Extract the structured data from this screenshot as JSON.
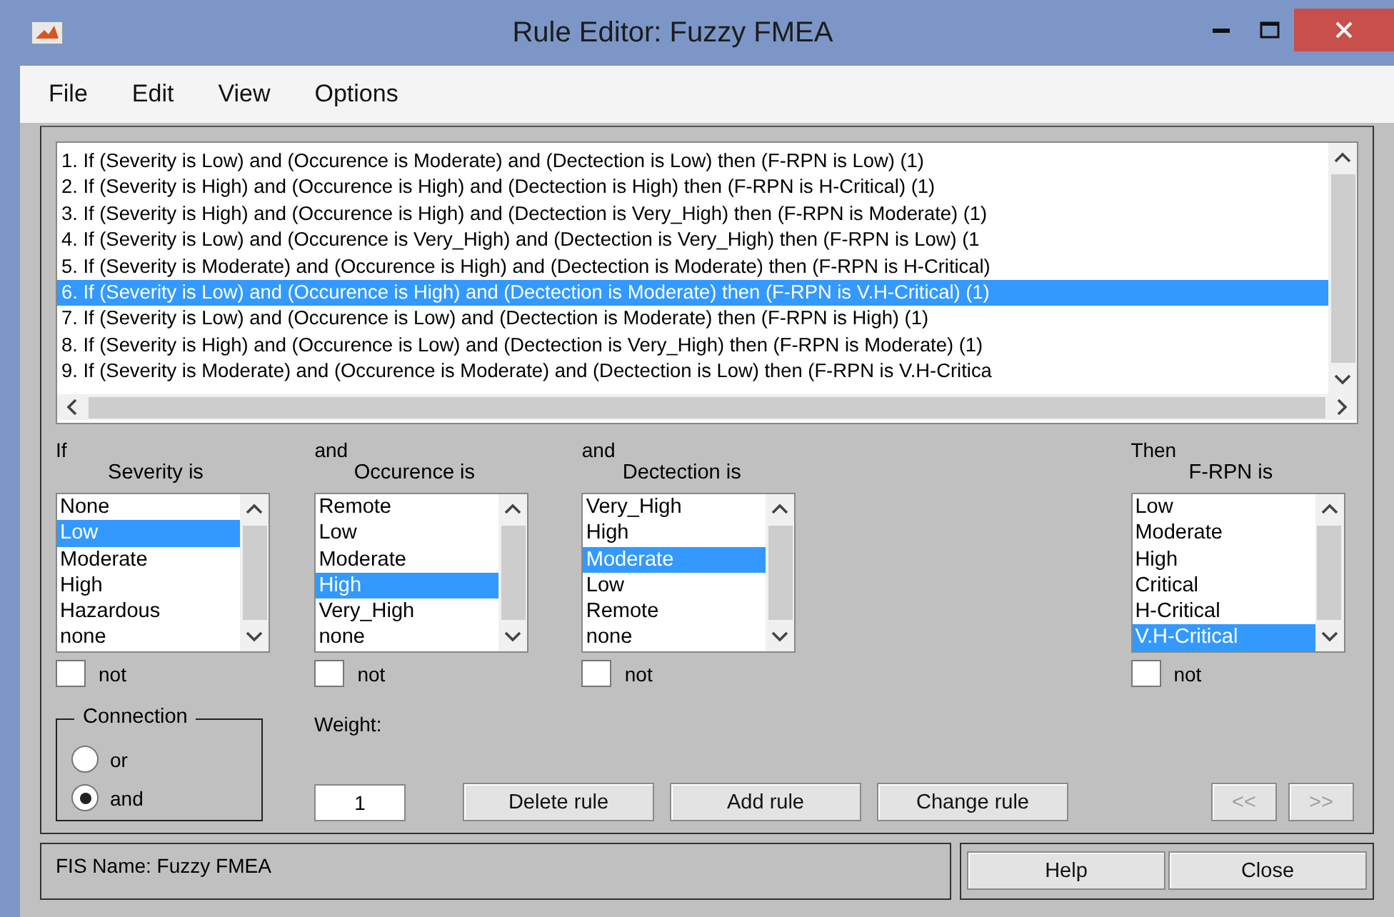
{
  "window": {
    "title": "Rule Editor: Fuzzy FMEA"
  },
  "menu": [
    "File",
    "Edit",
    "View",
    "Options"
  ],
  "rules": [
    {
      "text": "1. If (Severity is Low) and (Occurence is Moderate) and (Dectection is Low) then (F-RPN is Low) (1)",
      "selected": false
    },
    {
      "text": "2. If (Severity is High) and (Occurence is High) and (Dectection is High) then (F-RPN is H-Critical) (1)",
      "selected": false
    },
    {
      "text": "3. If (Severity is High) and (Occurence is High) and (Dectection is Very_High) then (F-RPN is Moderate) (1)",
      "selected": false
    },
    {
      "text": "4. If (Severity is Low) and (Occurence is Very_High) and (Dectection is Very_High) then (F-RPN is Low) (1",
      "selected": false
    },
    {
      "text": "5. If (Severity is Moderate) and (Occurence is High) and (Dectection is Moderate) then (F-RPN is H-Critical)",
      "selected": false
    },
    {
      "text": "6. If (Severity is Low) and (Occurence is High) and (Dectection is Moderate) then (F-RPN is V.H-Critical) (1)",
      "selected": true
    },
    {
      "text": "7. If (Severity is Low) and (Occurence is Low) and (Dectection is Moderate) then (F-RPN is High) (1)",
      "selected": false
    },
    {
      "text": "8. If (Severity is High) and (Occurence is Low) and (Dectection is Very_High) then (F-RPN is Moderate) (1)",
      "selected": false
    },
    {
      "text": "9. If (Severity is Moderate) and (Occurence is Moderate) and (Dectection is Low) then (F-RPN is V.H-Critica",
      "selected": false
    }
  ],
  "antecedents": [
    {
      "prefix": "If",
      "label": "Severity is",
      "not": false,
      "not_label": "not",
      "options": [
        {
          "label": "None",
          "selected": false
        },
        {
          "label": "Low",
          "selected": true
        },
        {
          "label": "Moderate",
          "selected": false
        },
        {
          "label": "High",
          "selected": false
        },
        {
          "label": "Hazardous",
          "selected": false
        },
        {
          "label": "none",
          "selected": false
        }
      ]
    },
    {
      "prefix": "and",
      "label": "Occurence is",
      "not": false,
      "not_label": "not",
      "options": [
        {
          "label": "Remote",
          "selected": false
        },
        {
          "label": "Low",
          "selected": false
        },
        {
          "label": "Moderate",
          "selected": false
        },
        {
          "label": "High",
          "selected": true
        },
        {
          "label": "Very_High",
          "selected": false
        },
        {
          "label": "none",
          "selected": false
        }
      ]
    },
    {
      "prefix": "and",
      "label": "Dectection is",
      "not": false,
      "not_label": "not",
      "options": [
        {
          "label": "Very_High",
          "selected": false
        },
        {
          "label": "High",
          "selected": false
        },
        {
          "label": "Moderate",
          "selected": true
        },
        {
          "label": "Low",
          "selected": false
        },
        {
          "label": "Remote",
          "selected": false
        },
        {
          "label": "none",
          "selected": false
        }
      ]
    }
  ],
  "consequent": {
    "prefix": "Then",
    "label": "F-RPN is",
    "not": false,
    "not_label": "not",
    "options": [
      {
        "label": "Low",
        "selected": false
      },
      {
        "label": "Moderate",
        "selected": false
      },
      {
        "label": "High",
        "selected": false
      },
      {
        "label": "Critical",
        "selected": false
      },
      {
        "label": "H-Critical",
        "selected": false
      },
      {
        "label": "V.H-Critical",
        "selected": true
      }
    ]
  },
  "connection": {
    "title": "Connection",
    "options": [
      {
        "label": "or",
        "selected": false
      },
      {
        "label": "and",
        "selected": true
      }
    ]
  },
  "weight": {
    "label": "Weight:",
    "value": "1"
  },
  "buttons": [
    {
      "label": "Delete rule",
      "disabled": false
    },
    {
      "label": "Add rule",
      "disabled": false
    },
    {
      "label": "Change rule",
      "disabled": false
    }
  ],
  "nav_buttons": [
    {
      "label": "<<",
      "disabled": true
    },
    {
      "label": ">>",
      "disabled": true
    }
  ],
  "status": "FIS Name: Fuzzy FMEA",
  "footer_buttons": [
    "Help",
    "Close"
  ]
}
